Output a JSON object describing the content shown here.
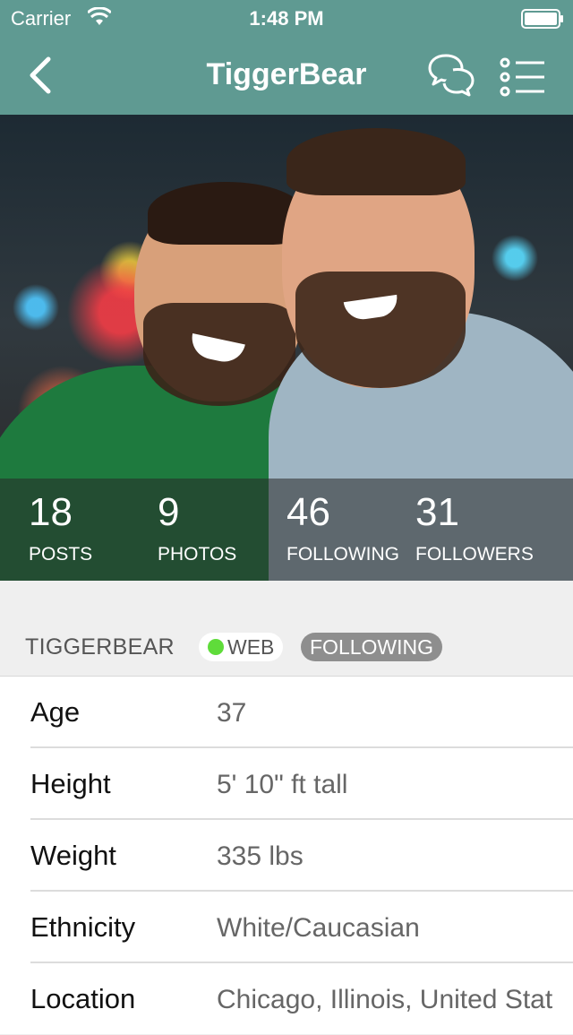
{
  "status_bar": {
    "carrier": "Carrier",
    "time": "1:48 PM"
  },
  "nav": {
    "title": "TiggerBear",
    "back_icon": "chevron-left-icon",
    "chat_icon": "chat-bubbles-icon",
    "menu_icon": "list-menu-icon"
  },
  "stats": [
    {
      "value": "18",
      "label": "POSTS"
    },
    {
      "value": "9",
      "label": "PHOTOS"
    },
    {
      "value": "46",
      "label": "FOLLOWING"
    },
    {
      "value": "31",
      "label": "FOLLOWERS"
    }
  ],
  "profile": {
    "username": "TIGGERBEAR",
    "web_badge": "WEB",
    "following_badge": "FOLLOWING"
  },
  "details": [
    {
      "key": "Age",
      "value": "37"
    },
    {
      "key": "Height",
      "value": "5' 10\" ft tall"
    },
    {
      "key": "Weight",
      "value": "335 lbs"
    },
    {
      "key": "Ethnicity",
      "value": "White/Caucasian"
    },
    {
      "key": "Location",
      "value": "Chicago, Illinois, United Stat"
    }
  ],
  "colors": {
    "header_teal": "#5f9a92",
    "online_green": "#5fdc3a",
    "following_gray": "#8e8e8e"
  }
}
